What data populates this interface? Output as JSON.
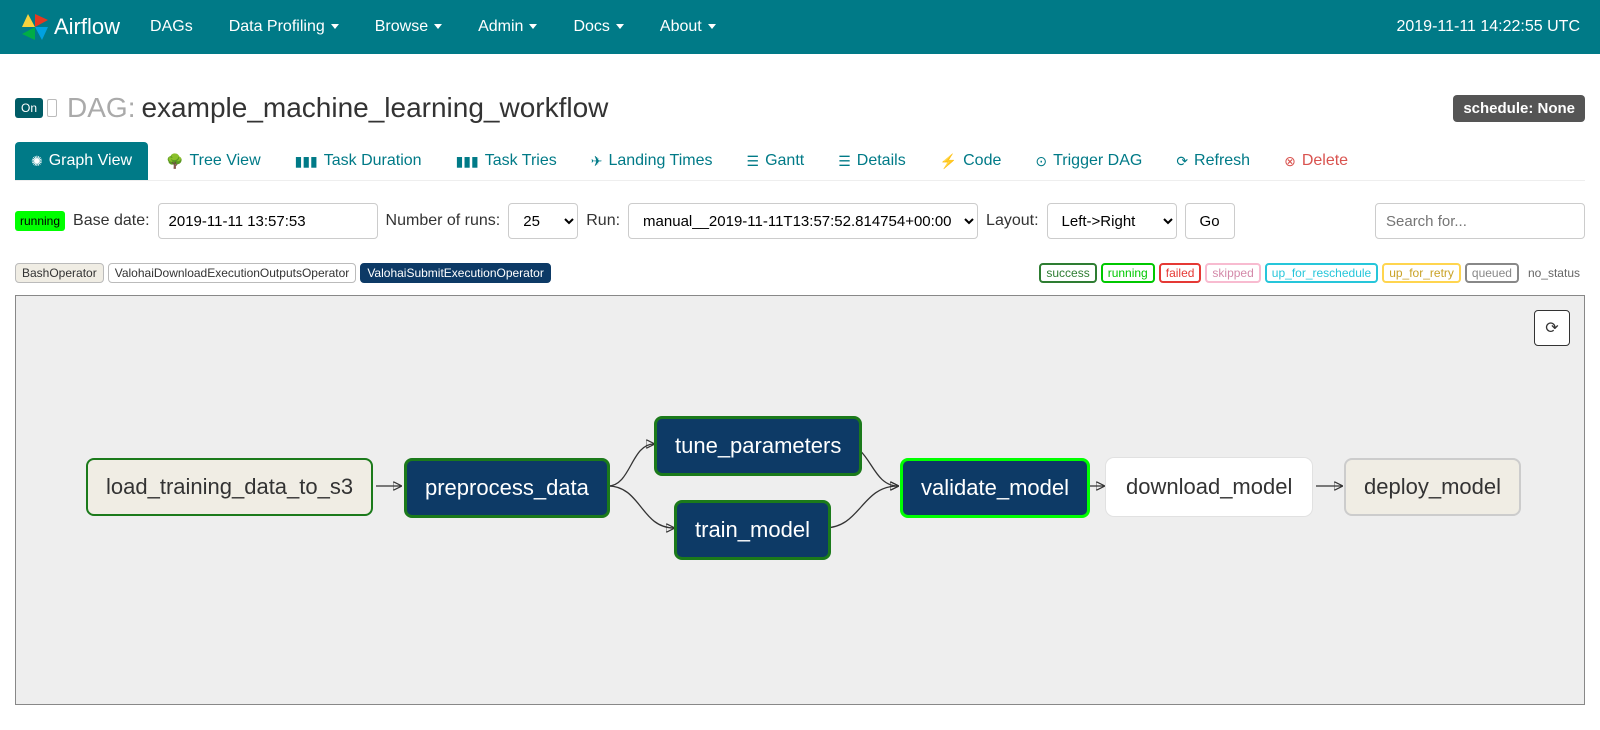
{
  "navbar": {
    "brand": "Airflow",
    "items": [
      "DAGs",
      "Data Profiling",
      "Browse",
      "Admin",
      "Docs",
      "About"
    ],
    "dropdown": [
      false,
      true,
      true,
      true,
      true,
      true
    ],
    "clock": "2019-11-11 14:22:55 UTC"
  },
  "header": {
    "toggle": "On",
    "label": "DAG:",
    "name": "example_machine_learning_workflow",
    "schedule": "schedule: None"
  },
  "tabs": [
    {
      "label": "Graph View",
      "active": true
    },
    {
      "label": "Tree View"
    },
    {
      "label": "Task Duration"
    },
    {
      "label": "Task Tries"
    },
    {
      "label": "Landing Times"
    },
    {
      "label": "Gantt"
    },
    {
      "label": "Details"
    },
    {
      "label": "Code"
    },
    {
      "label": "Trigger DAG"
    },
    {
      "label": "Refresh"
    },
    {
      "label": "Delete",
      "delete": true
    }
  ],
  "controls": {
    "status": "running",
    "base_date_label": "Base date:",
    "base_date": "2019-11-11 13:57:53",
    "num_runs_label": "Number of runs:",
    "num_runs": "25",
    "run_label": "Run:",
    "run": "manual__2019-11-11T13:57:52.814754+00:00",
    "layout_label": "Layout:",
    "layout": "Left->Right",
    "go": "Go",
    "search_placeholder": "Search for..."
  },
  "operators": [
    {
      "label": "BashOperator",
      "cls": "bash"
    },
    {
      "label": "ValohaiDownloadExecutionOutputsOperator",
      "cls": "download"
    },
    {
      "label": "ValohaiSubmitExecutionOperator",
      "cls": "submit"
    }
  ],
  "states": [
    {
      "label": "success",
      "cls": "st-success"
    },
    {
      "label": "running",
      "cls": "st-running"
    },
    {
      "label": "failed",
      "cls": "st-failed"
    },
    {
      "label": "skipped",
      "cls": "st-skipped"
    },
    {
      "label": "up_for_reschedule",
      "cls": "st-reschedule"
    },
    {
      "label": "up_for_retry",
      "cls": "st-retry"
    },
    {
      "label": "queued",
      "cls": "st-queued"
    }
  ],
  "no_status": "no_status",
  "graph": {
    "nodes": {
      "n1": "load_training_data_to_s3",
      "n2": "preprocess_data",
      "n3": "tune_parameters",
      "n4": "train_model",
      "n5": "validate_model",
      "n6": "download_model",
      "n7": "deploy_model"
    }
  }
}
